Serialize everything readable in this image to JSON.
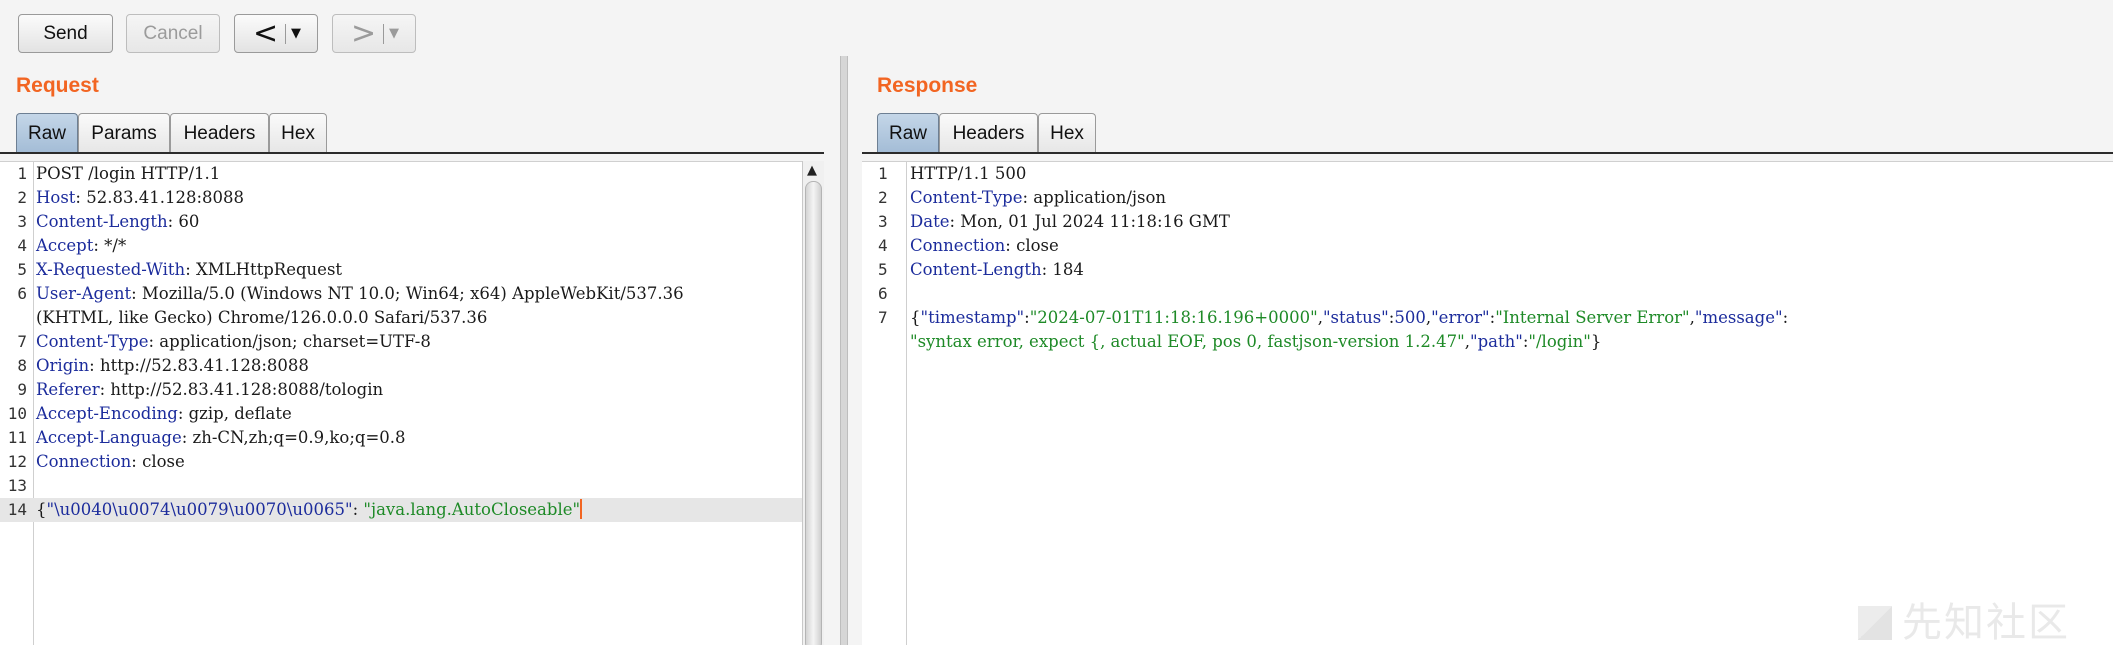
{
  "toolbar": {
    "send_label": "Send",
    "cancel_label": "Cancel",
    "back_arrow": "<",
    "forward_arrow": ">",
    "dropdown_arrow": "▼"
  },
  "request": {
    "title": "Request",
    "tabs": [
      "Raw",
      "Params",
      "Headers",
      "Hex"
    ],
    "active_tab": "Raw",
    "lines": [
      {
        "n": "1",
        "header": "",
        "value": "POST /login HTTP/1.1"
      },
      {
        "n": "2",
        "header": "Host",
        "value": ": 52.83.41.128:8088"
      },
      {
        "n": "3",
        "header": "Content-Length",
        "value": ": 60"
      },
      {
        "n": "4",
        "header": "Accept",
        "value": ": */*"
      },
      {
        "n": "5",
        "header": "X-Requested-With",
        "value": ": XMLHttpRequest"
      },
      {
        "n": "6",
        "header": "User-Agent",
        "value": ": Mozilla/5.0 (Windows NT 10.0; Win64; x64) AppleWebKit/537.36"
      },
      {
        "n": "",
        "header": "",
        "value": "(KHTML, like Gecko) Chrome/126.0.0.0 Safari/537.36"
      },
      {
        "n": "7",
        "header": "Content-Type",
        "value": ": application/json; charset=UTF-8"
      },
      {
        "n": "8",
        "header": "Origin",
        "value": ": http://52.83.41.128:8088"
      },
      {
        "n": "9",
        "header": "Referer",
        "value": ": http://52.83.41.128:8088/tologin"
      },
      {
        "n": "10",
        "header": "Accept-Encoding",
        "value": ": gzip, deflate"
      },
      {
        "n": "11",
        "header": "Accept-Language",
        "value": ": zh-CN,zh;q=0.9,ko;q=0.8"
      },
      {
        "n": "12",
        "header": "Connection",
        "value": ": close"
      },
      {
        "n": "13",
        "header": "",
        "value": ""
      }
    ],
    "body_line": {
      "n": "14",
      "open": "{",
      "key": "\"\\u0040\\u0074\\u0079\\u0070\\u0065\"",
      "sep": ": ",
      "value": "\"java.lang.AutoCloseable\""
    }
  },
  "response": {
    "title": "Response",
    "tabs": [
      "Raw",
      "Headers",
      "Hex"
    ],
    "active_tab": "Raw",
    "lines": [
      {
        "n": "1",
        "header": "",
        "value": "HTTP/1.1 500"
      },
      {
        "n": "2",
        "header": "Content-Type",
        "value": ": application/json"
      },
      {
        "n": "3",
        "header": "Date",
        "value": ": Mon, 01 Jul 2024 11:18:16 GMT"
      },
      {
        "n": "4",
        "header": "Connection",
        "value": ": close"
      },
      {
        "n": "5",
        "header": "Content-Length",
        "value": ": 184"
      },
      {
        "n": "6",
        "header": "",
        "value": ""
      }
    ],
    "body": {
      "n": "7",
      "open": "{",
      "k1": "\"timestamp\"",
      "v1": "\"2024-07-01T11:18:16.196+0000\"",
      "k2": "\"status\"",
      "v2": "500",
      "k3": "\"error\"",
      "v3": "\"Internal Server Error\"",
      "k4": "\"message\"",
      "v4": "\"syntax error, expect {, actual EOF, pos 0, fastjson-version 1.2.47\"",
      "k5": "\"path\"",
      "v5": "\"/login\"",
      "close": "}"
    }
  },
  "watermark": "先知社区",
  "colors": {
    "accent_title": "#f26522",
    "header_name": "#1c2c9c",
    "json_string": "#1e8a27",
    "active_tab": "#a3bcd6"
  }
}
